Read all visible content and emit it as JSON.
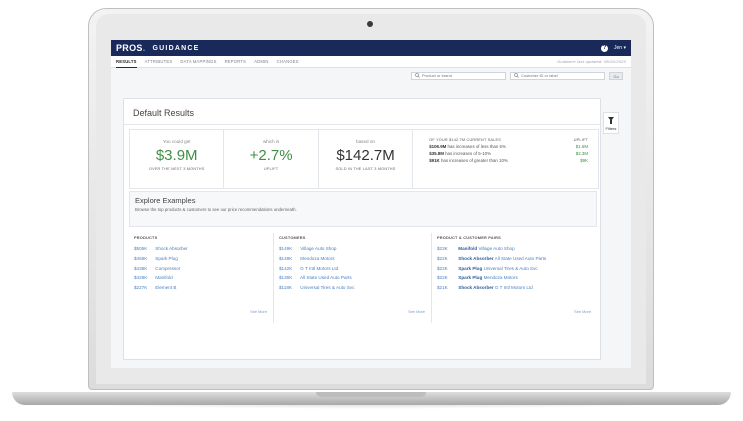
{
  "app": {
    "logo": "PROS",
    "logo_dot": ".",
    "title": "GUIDANCE",
    "user": "Jen ▾"
  },
  "nav": {
    "items": [
      "RESULTS",
      "ATTRIBUTES",
      "DATA MAPPINGS",
      "REPORTS",
      "ADMIN",
      "CHANGES"
    ],
    "active_index": 0,
    "status": "Guidance last updated: 08/26/2020"
  },
  "search": {
    "product_placeholder": "Product or brand",
    "customer_placeholder": "Customer ID or label",
    "go_label": "Go"
  },
  "filters_label": "Filters",
  "results": {
    "title": "Default Results",
    "metric1": {
      "label": "You could get",
      "value": "$3.9M",
      "sub": "OVER THE NEXT 3 MONTHS"
    },
    "metric2": {
      "label": "which is",
      "value": "+2.7%",
      "sub": "UPLIFT"
    },
    "metric3": {
      "label": "based on",
      "value": "$142.7M",
      "sub": "SOLD IN THE LAST 3 MONTHS"
    },
    "sales": {
      "header": "OF YOUR $142.7M CURRENT SALES",
      "uplift_header": "UPLIFT",
      "rows": [
        {
          "amount": "$106.9M",
          "text": "has increases of less than 5%",
          "uplift": "$1.6M"
        },
        {
          "amount": "$35.8M",
          "text": "has increases of 5-10%",
          "uplift": "$2.3M"
        },
        {
          "amount": "$91K",
          "text": "has increases of greater than 10%",
          "uplift": "$9K"
        }
      ]
    }
  },
  "explore": {
    "title": "Explore Examples",
    "subtitle": "Browse the top products & customers to see our price recommendations underneath."
  },
  "products": {
    "header": "PRODUCTS",
    "items": [
      {
        "amount": "$505K",
        "name": "Shock Absorber"
      },
      {
        "amount": "$468K",
        "name": "Spark Plug"
      },
      {
        "amount": "$438K",
        "name": "Compressor"
      },
      {
        "amount": "$428K",
        "name": "Manifold"
      },
      {
        "amount": "$227K",
        "name": "Element B"
      }
    ],
    "see_more": "See More"
  },
  "customers": {
    "header": "CUSTOMERS",
    "items": [
      {
        "amount": "$149K",
        "name": "Village Auto Shop"
      },
      {
        "amount": "$148K",
        "name": "Mendoza Motors"
      },
      {
        "amount": "$142K",
        "name": "G T Intl Motors Ltd"
      },
      {
        "amount": "$136K",
        "name": "All State Used Auto Parts"
      },
      {
        "amount": "$118K",
        "name": "Universal Tires & Auto Svc"
      }
    ],
    "see_more": "See More"
  },
  "pairs": {
    "header": "PRODUCT & CUSTOMER PAIRS",
    "items": [
      {
        "amount": "$23K",
        "product": "Manifold",
        "customer": "Village Auto Shop"
      },
      {
        "amount": "$22K",
        "product": "Shock Absorber",
        "customer": "All State Used Auto Parts"
      },
      {
        "amount": "$22K",
        "product": "Spark Plug",
        "customer": "Universal Tires & Auto Svc"
      },
      {
        "amount": "$22K",
        "product": "Spark Plug",
        "customer": "Mendoza Motors"
      },
      {
        "amount": "$21K",
        "product": "Shock Absorber",
        "customer": "G T Intl Motors Ltd"
      }
    ],
    "see_more": "See More"
  },
  "colors": {
    "topbar": "#18295a",
    "positive": "#3e8f45",
    "link": "#4a7fc1"
  }
}
